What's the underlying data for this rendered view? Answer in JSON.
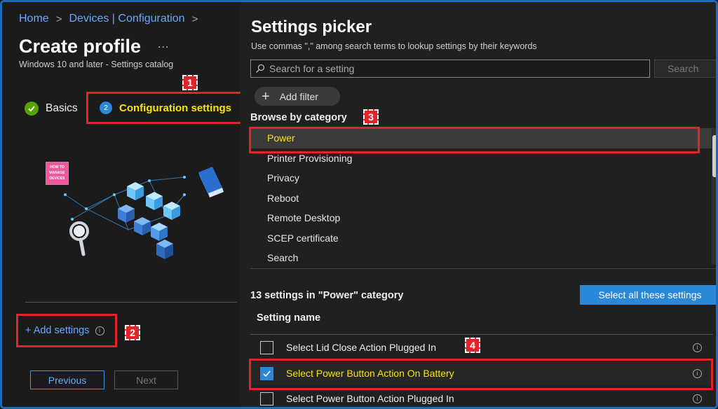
{
  "breadcrumb": {
    "home": "Home",
    "devices": "Devices | Configuration",
    "sep": ">"
  },
  "page": {
    "title": "Create profile",
    "more": "...",
    "subtitle": "Windows 10 and later - Settings catalog"
  },
  "steps": {
    "basics": "Basics",
    "config_number": "2",
    "config": "Configuration settings"
  },
  "badges": {
    "b1": "1",
    "b2": "2",
    "b3": "3",
    "b4": "4"
  },
  "logo_text": "HOW TO MANAGE DEVICES",
  "add_settings": {
    "label": "+ Add settings",
    "info": "i"
  },
  "nav": {
    "previous": "Previous",
    "next": "Next"
  },
  "picker": {
    "title": "Settings picker",
    "hint": "Use commas \",\" among search terms to lookup settings by their keywords",
    "search_placeholder": "Search for a setting",
    "search_button": "Search",
    "add_filter": "Add filter",
    "add_filter_plus": "+",
    "browse_label": "Browse by category",
    "categories": [
      "Power",
      "Printer Provisioning",
      "Privacy",
      "Reboot",
      "Remote Desktop",
      "SCEP certificate",
      "Search"
    ],
    "count_label": "13 settings in \"Power\" category",
    "select_all": "Select all these settings",
    "column_header": "Setting name",
    "settings": [
      {
        "name": "Select Lid Close Action Plugged In",
        "checked": false
      },
      {
        "name": "Select Power Button Action On Battery",
        "checked": true
      },
      {
        "name": "Select Power Button Action Plugged In",
        "checked": false
      }
    ],
    "info": "i"
  },
  "colors": {
    "accent": "#2b88d8",
    "highlight": "#e0242b",
    "selected_text": "#f7e600",
    "success": "#57a300"
  }
}
